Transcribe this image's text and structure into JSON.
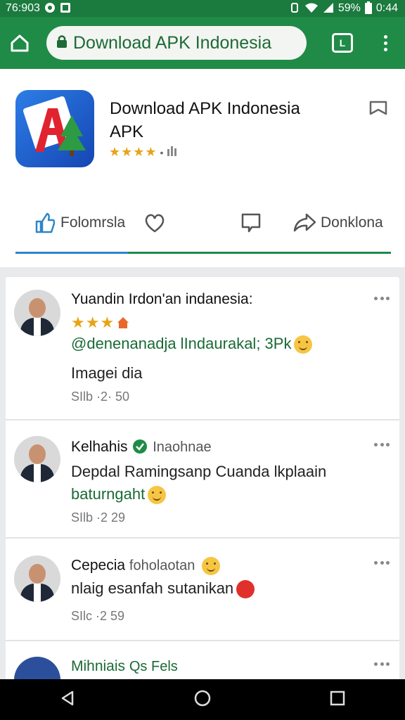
{
  "status_bar": {
    "time_left": "76:903",
    "battery": "59%",
    "clock": "0:44"
  },
  "browser": {
    "url": "Download APK Indonesia",
    "tabs_count": "L"
  },
  "app": {
    "title_line1": "Download APK Indonesia",
    "title_line2": "APK",
    "stars": "★★★★",
    "rating_sep": "•"
  },
  "actions": {
    "follow": "Folomrsla",
    "download": "Donklona"
  },
  "posts": [
    {
      "name": "Yuandin Irdon'an indanesia:",
      "stars": "★★★",
      "line1": "@denenanadja lIndaurakal; 3Pk",
      "line2": "Imagei dia",
      "meta": "SIlb ·2· 50"
    },
    {
      "name": "Kelhahis",
      "sub": "Inaohnae",
      "line1": "Depdal Ramingsanp Cuanda lkplaain",
      "line2": "baturngaht",
      "meta": "SIlb ·2  29"
    },
    {
      "name": "Cepecia",
      "sub": "foholaotan",
      "line1": "nlaig esanfah sutanikan",
      "meta": "SIlc ·2  59"
    },
    {
      "name": "Mihniais",
      "sub": "Qs Fels"
    }
  ],
  "colors": {
    "brand_green": "#1f8b47",
    "link_blue": "#2b86c9"
  }
}
